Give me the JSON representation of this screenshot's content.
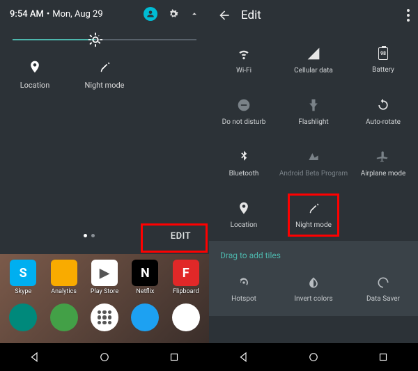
{
  "left": {
    "time": "9:54 AM",
    "date": "Mon, Aug 29",
    "tiles": [
      {
        "label": "Location"
      },
      {
        "label": "Night mode"
      }
    ],
    "edit_btn": "EDIT",
    "apps_row1": [
      {
        "label": "Skype",
        "bg": "#00aff0",
        "letter": "S"
      },
      {
        "label": "Analytics",
        "bg": "#f9ab00",
        "letter": ""
      },
      {
        "label": "Play Store",
        "bg": "#ffffff",
        "letter": "▶"
      },
      {
        "label": "Netflix",
        "bg": "#000000",
        "letter": "N"
      },
      {
        "label": "Flipboard",
        "bg": "#e12828",
        "letter": "F"
      }
    ],
    "dock": [
      {
        "bg": "#00897b"
      },
      {
        "bg": "#43a047"
      },
      {
        "bg": "#ffffff"
      },
      {
        "bg": "#1da1f2"
      },
      {
        "bg": "#ffffff"
      }
    ]
  },
  "right": {
    "title": "Edit",
    "grid": [
      {
        "label": "Wi-Fi",
        "icon": "wifi"
      },
      {
        "label": "Cellular data",
        "icon": "cell"
      },
      {
        "label": "Battery",
        "icon": "battery",
        "value": "98"
      },
      {
        "label": "Do not disturb",
        "icon": "dnd",
        "dim": true
      },
      {
        "label": "Flashlight",
        "icon": "flash",
        "dim": true
      },
      {
        "label": "Auto-rotate",
        "icon": "rotate"
      },
      {
        "label": "Bluetooth",
        "icon": "bt"
      },
      {
        "label": "Android Beta Program",
        "icon": "beta",
        "dimlabel": true,
        "dim": true
      },
      {
        "label": "Airplane mode",
        "icon": "airplane",
        "dim": true
      },
      {
        "label": "Location",
        "icon": "location"
      },
      {
        "label": "Night mode",
        "icon": "night",
        "highlight": true
      }
    ],
    "drag_title": "Drag to add tiles",
    "drag_tiles": [
      {
        "label": "Hotspot",
        "icon": "hotspot"
      },
      {
        "label": "Invert colors",
        "icon": "invert"
      },
      {
        "label": "Data Saver",
        "icon": "datasaver"
      }
    ]
  }
}
